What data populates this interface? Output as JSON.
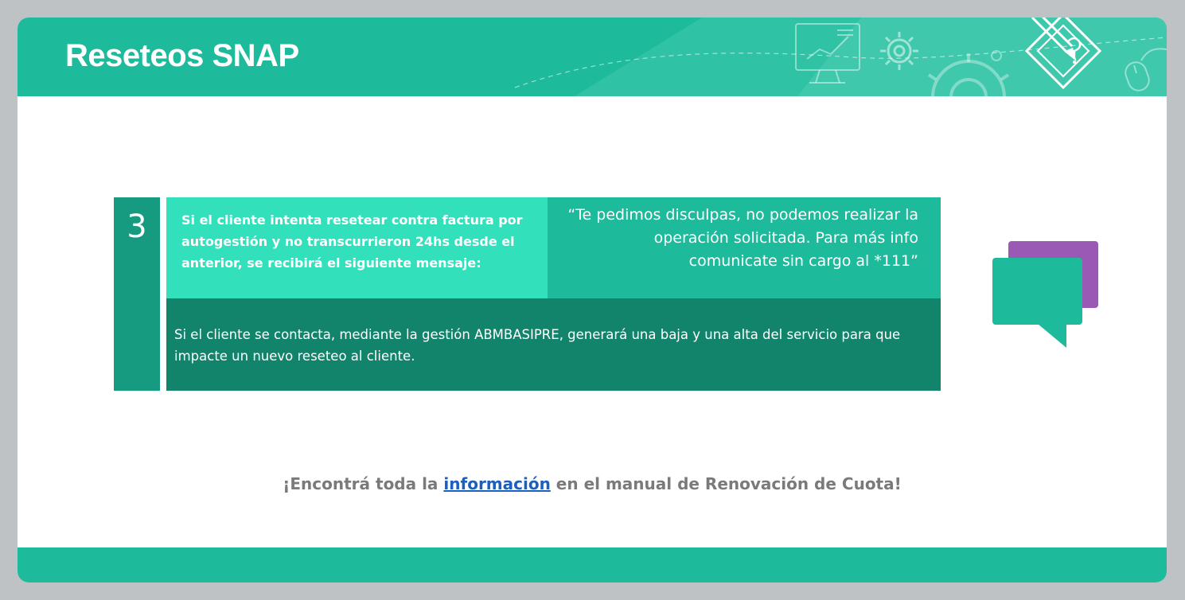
{
  "header": {
    "title": "Reseteos SNAP"
  },
  "step": {
    "number": "3",
    "condition": "Si el cliente intenta resetear contra factura por autogestión y no transcurrieron 24hs desde el anterior, se recibirá el siguiente mensaje:",
    "message": "“Te pedimos disculpas, no podemos realizar la operación solicitada. Para más info comunicate sin cargo al *111”",
    "action": "Si el cliente se contacta, mediante la gestión ABMBASIPRE, generará una baja y una alta del servicio para que impacte un nuevo reseteo al cliente."
  },
  "footer_note": {
    "prefix": "¡Encontrá toda la ",
    "link": "información",
    "suffix": " en el manual de Renovación de Cuota!"
  },
  "icons": {
    "header": [
      "monitor-chart-icon",
      "gear-icon",
      "large-gear-icon",
      "puzzle-pencil-icon",
      "mouse-icon"
    ],
    "side": "chat-bubbles-icon"
  },
  "colors": {
    "header": "#1dba9b",
    "step_dark": "#169a80",
    "condition_bg": "#33e0bc",
    "message_bg": "#1dba9b",
    "action_bg": "#12846c",
    "chat_purple": "#9b59b6",
    "link": "#1b5fc0"
  }
}
